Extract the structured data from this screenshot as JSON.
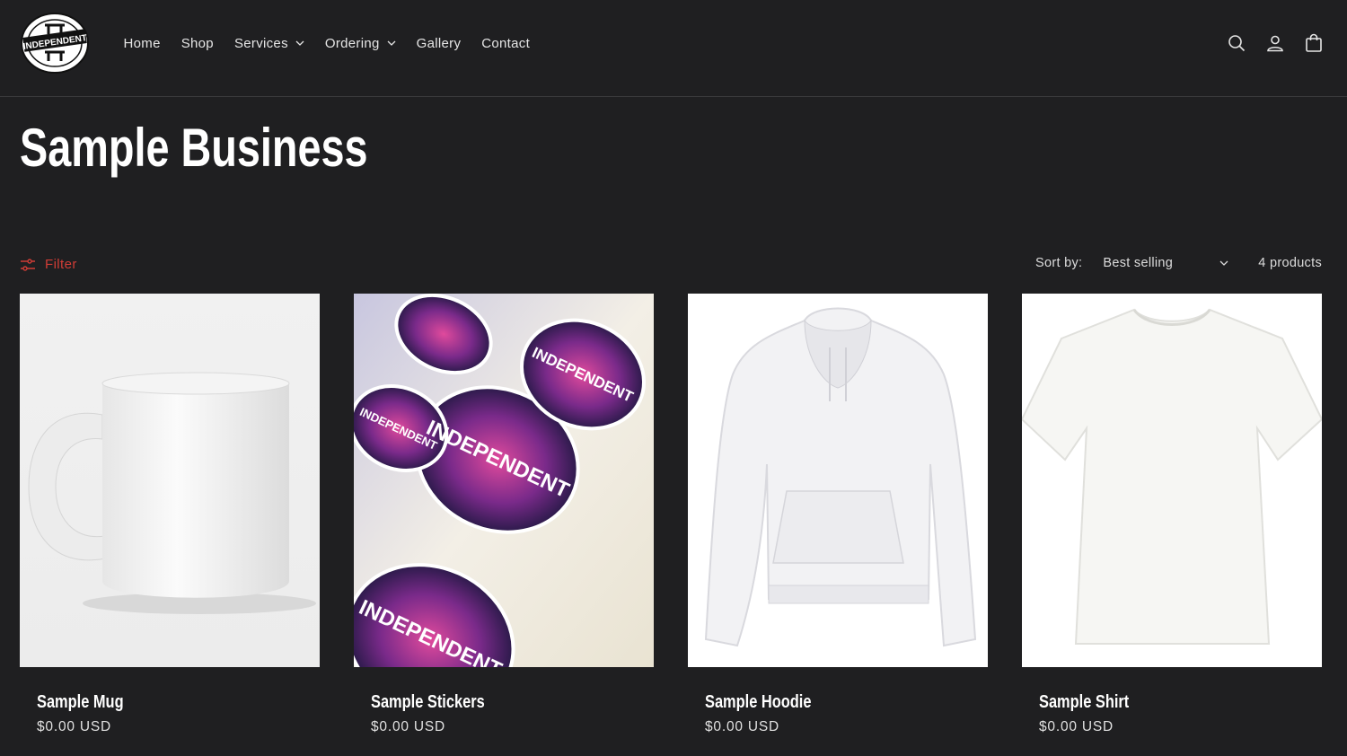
{
  "header": {
    "logo_text": "INDEPENDENT",
    "nav": [
      {
        "label": "Home",
        "dropdown": false
      },
      {
        "label": "Shop",
        "dropdown": false
      },
      {
        "label": "Services",
        "dropdown": true
      },
      {
        "label": "Ordering",
        "dropdown": true
      },
      {
        "label": "Gallery",
        "dropdown": false
      },
      {
        "label": "Contact",
        "dropdown": false
      }
    ],
    "icons": [
      "search-icon",
      "account-icon",
      "cart-icon"
    ]
  },
  "page": {
    "title": "Sample Business"
  },
  "toolbar": {
    "filter_label": "Filter",
    "sort_label": "Sort by:",
    "sort_value": "Best selling",
    "product_count": "4 products"
  },
  "products": [
    {
      "title": "Sample Mug",
      "price": "$0.00 USD",
      "image": "mug"
    },
    {
      "title": "Sample Stickers",
      "price": "$0.00 USD",
      "image": "stickers"
    },
    {
      "title": "Sample Hoodie",
      "price": "$0.00 USD",
      "image": "hoodie"
    },
    {
      "title": "Sample Shirt",
      "price": "$0.00 USD",
      "image": "shirt"
    }
  ],
  "colors": {
    "background": "#1f1f21",
    "accent": "#d13d36",
    "text": "#ffffff"
  }
}
